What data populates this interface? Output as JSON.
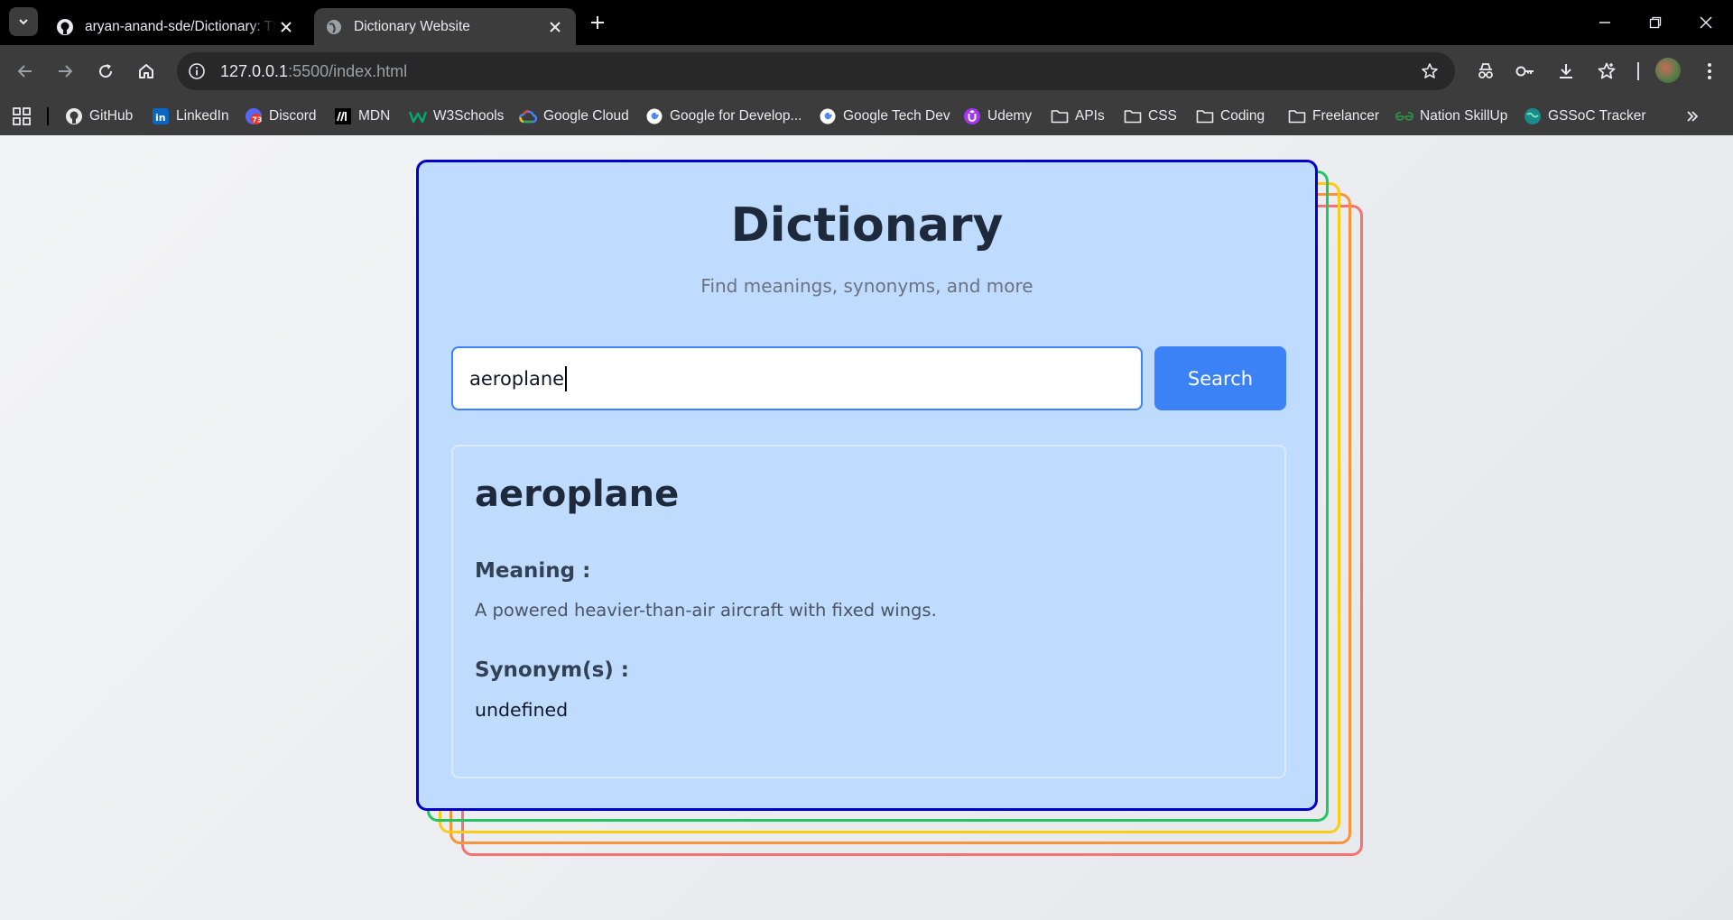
{
  "browser": {
    "tabs": [
      {
        "title": "aryan-anand-sde/Dictionary: Th",
        "favicon": "github-icon",
        "active": false
      },
      {
        "title": "Dictionary Website",
        "favicon": "globe-icon",
        "active": true
      }
    ],
    "address": {
      "host": "127.0.0.1",
      "rest": ":5500/index.html"
    },
    "bookmarks": [
      {
        "label": "GitHub",
        "icon": "github-icon"
      },
      {
        "label": "LinkedIn",
        "icon": "linkedin-icon"
      },
      {
        "label": "Discord",
        "icon": "discord-icon",
        "badge": "73"
      },
      {
        "label": "MDN",
        "icon": "mdn-icon"
      },
      {
        "label": "W3Schools",
        "icon": "w3schools-icon"
      },
      {
        "label": "Google Cloud",
        "icon": "google-cloud-icon"
      },
      {
        "label": "Google for Develop...",
        "icon": "google-icon"
      },
      {
        "label": "Google Tech Dev",
        "icon": "google-icon"
      },
      {
        "label": "Udemy",
        "icon": "udemy-icon"
      },
      {
        "label": "APIs",
        "icon": "folder-icon"
      },
      {
        "label": "CSS",
        "icon": "folder-icon"
      },
      {
        "label": "Coding",
        "icon": "folder-icon"
      },
      {
        "label": "Freelancer",
        "icon": "folder-icon"
      },
      {
        "label": "Nation SkillUp",
        "icon": "geeksforgeeks-icon"
      },
      {
        "label": "GSSoC Tracker",
        "icon": "globe-icon"
      }
    ]
  },
  "app": {
    "title": "Dictionary",
    "subtitle": "Find meanings, synonyms, and more",
    "search": {
      "value": "aeroplane",
      "button_label": "Search"
    },
    "result": {
      "word": "aeroplane",
      "meaning_label": "Meaning :",
      "meaning": "A powered heavier-than-air aircraft with fixed wings.",
      "synonyms_label": "Synonym(s) :",
      "synonyms": "undefined"
    },
    "colors": {
      "card_border": "#0000cd",
      "stack_borders": [
        "#22c55e",
        "#facc15",
        "#fb923c",
        "#f87171"
      ],
      "accent": "#3b82f6",
      "card_bg": "#bfdbfe"
    }
  }
}
